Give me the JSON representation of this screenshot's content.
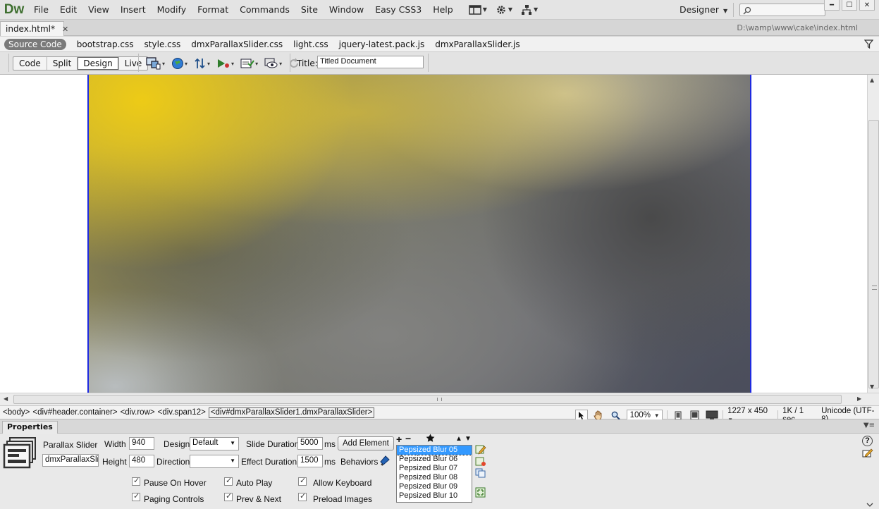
{
  "app": {
    "logo": "Dw",
    "menu": [
      "File",
      "Edit",
      "View",
      "Insert",
      "Modify",
      "Format",
      "Commands",
      "Site",
      "Window",
      "Easy CSS3",
      "Help"
    ],
    "workspace": "Designer",
    "search_placeholder": ""
  },
  "document": {
    "tab_label": "index.html*",
    "path": "D:\\wamp\\www\\cake\\index.html"
  },
  "related_files": [
    "Source Code",
    "bootstrap.css",
    "style.css",
    "dmxParallaxSlider.css",
    "light.css",
    "jquery-latest.pack.js",
    "dmxParallaxSlider.js"
  ],
  "toolbar": {
    "views": [
      "Code",
      "Split",
      "Design",
      "Live"
    ],
    "selected_view": "Design",
    "title_label": "Title:",
    "title_value": "Titled Document"
  },
  "status": {
    "breadcrumbs": [
      "<body>",
      "<div#header.container>",
      "<div.row>",
      "<div.span12>",
      "<div#dmxParallaxSlider1.dmxParallaxSlider>"
    ],
    "zoom": "100%",
    "dimensions": "1227 x 450",
    "download": "1K / 1 sec",
    "encoding": "Unicode (UTF-8)"
  },
  "properties": {
    "tab_label": "Properties",
    "widget_name": "Parallax Slider",
    "id_value": "dmxParallaxSlider1",
    "width_label": "Width",
    "width_value": "940",
    "height_label": "Height",
    "height_value": "480",
    "design_label": "Design",
    "design_value": "Default",
    "direction_label": "Direction",
    "direction_value": "",
    "slide_duration_label": "Slide Duration",
    "slide_duration_value": "5000",
    "effect_duration_label": "Effect Duration",
    "effect_duration_value": "1500",
    "ms_label": "ms",
    "add_element_label": "Add Element",
    "behaviors_label": "Behaviors",
    "checkboxes": {
      "pause_on_hover": "Pause On Hover",
      "paging_controls": "Paging Controls",
      "auto_play": "Auto Play",
      "prev_next": "Prev & Next",
      "allow_keyboard": "Allow Keyboard",
      "preload_images": "Preload Images"
    },
    "slides": [
      "Pepsized Blur 05",
      "Pepsized Blur 06",
      "Pepsized Blur 07",
      "Pepsized Blur 08",
      "Pepsized Blur 09",
      "Pepsized Blur 10"
    ],
    "selected_slide": "Pepsized Blur 05"
  }
}
